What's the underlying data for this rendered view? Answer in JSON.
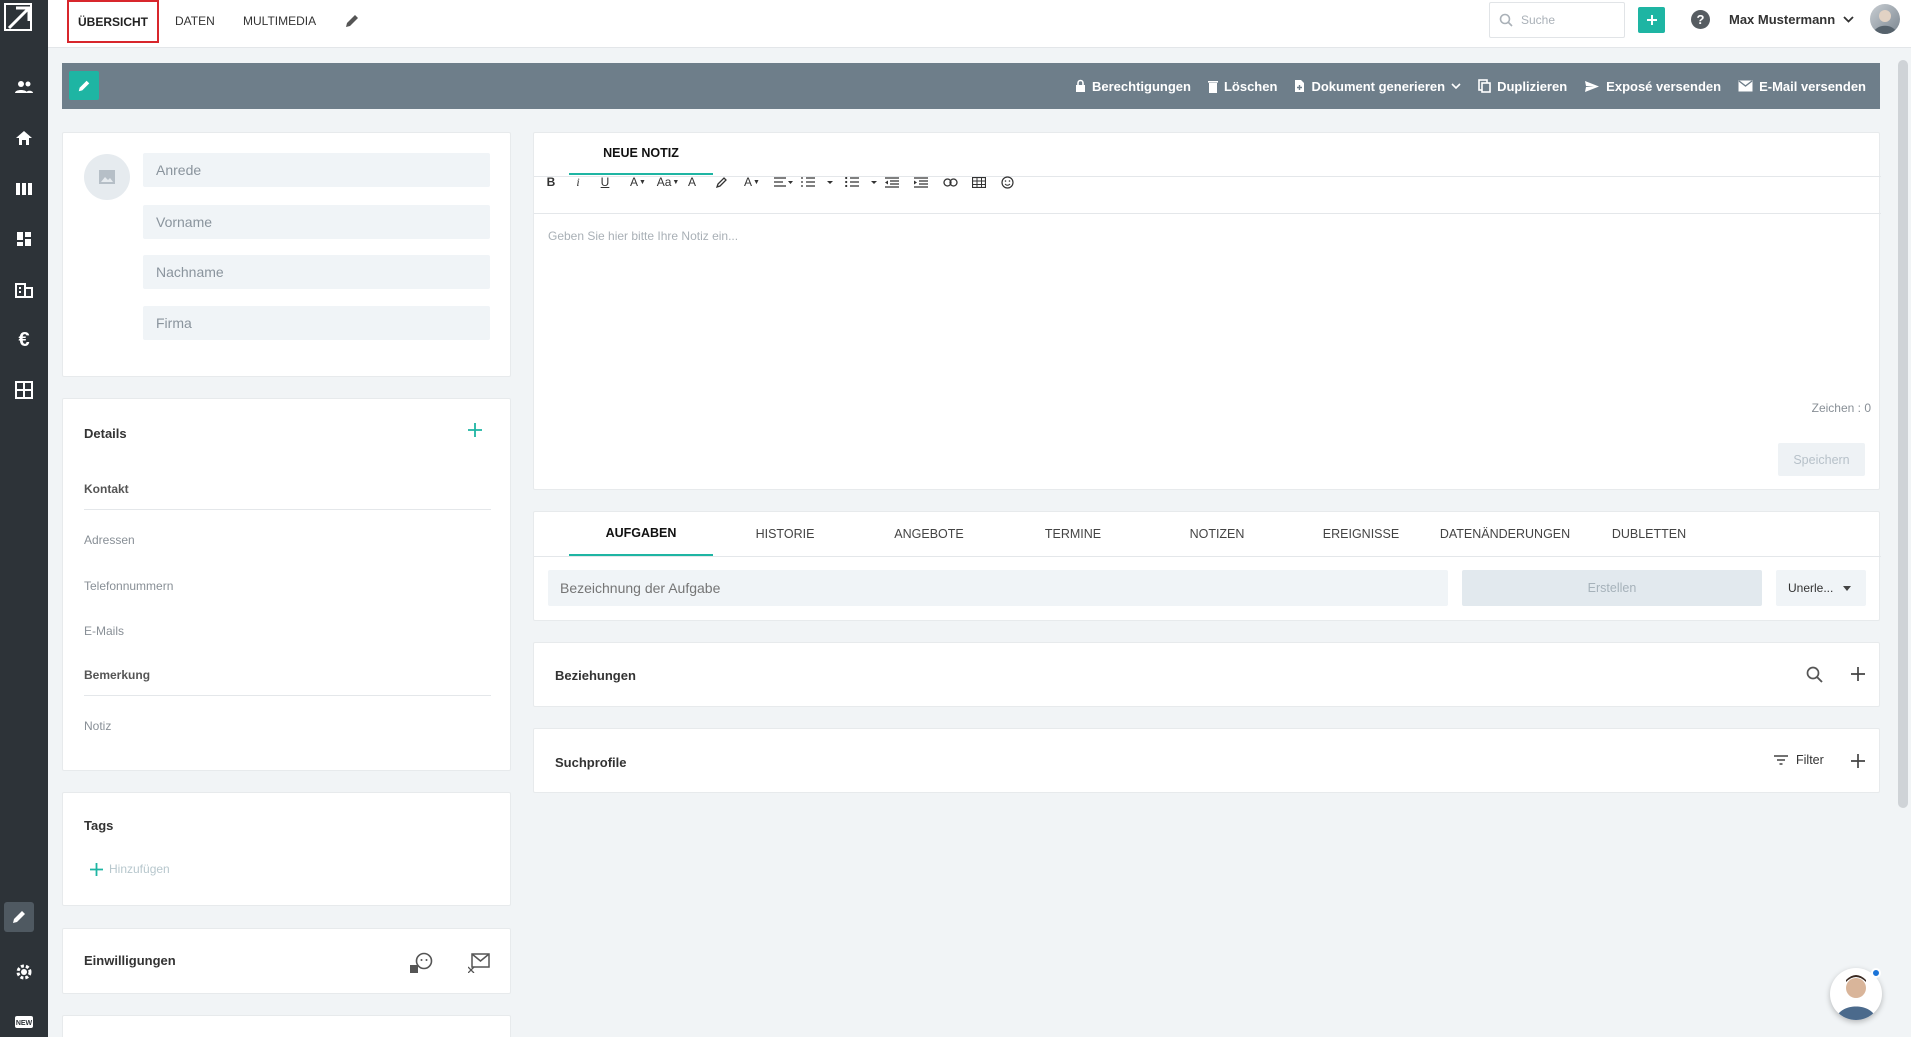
{
  "sidebar": {
    "icons": [
      "logo-icon",
      "contacts-icon",
      "home-icon",
      "books-icon",
      "dashboard-icon",
      "buildings-icon",
      "euro-icon",
      "grid-icon",
      "edit-icon",
      "settings-icon",
      "new-badge-icon"
    ]
  },
  "topbar": {
    "tabs": [
      {
        "label": "ÜBERSICHT"
      },
      {
        "label": "DATEN"
      },
      {
        "label": "MULTIMEDIA"
      }
    ],
    "search_placeholder": "Suche",
    "user_name": "Max Mustermann",
    "accent_color": "#1eb5a3"
  },
  "actionbar": {
    "actions": [
      {
        "label": "Berechtigungen",
        "icon": "lock-icon"
      },
      {
        "label": "Löschen",
        "icon": "trash-icon"
      },
      {
        "label": "Dokument generieren",
        "icon": "document-icon"
      },
      {
        "label": "Duplizieren",
        "icon": "copy-icon"
      },
      {
        "label": "Exposé versenden",
        "icon": "send-icon"
      },
      {
        "label": "E-Mail versenden",
        "icon": "mail-icon"
      }
    ]
  },
  "contact": {
    "fields": [
      {
        "placeholder": "Anrede"
      },
      {
        "placeholder": "Vorname"
      },
      {
        "placeholder": "Nachname"
      },
      {
        "placeholder": "Firma"
      }
    ]
  },
  "details": {
    "title": "Details",
    "kontakt_label": "Kontakt",
    "items": [
      "Adressen",
      "Telefonnummern",
      "E-Mails"
    ],
    "bemerkung_label": "Bemerkung",
    "notiz_label": "Notiz"
  },
  "tags": {
    "title": "Tags",
    "add_label": "Hinzufügen"
  },
  "einwilligungen": {
    "title": "Einwilligungen"
  },
  "note": {
    "tab_label": "NEUE NOTIZ",
    "placeholder": "Geben Sie hier bitte Ihre Notiz ein...",
    "char_count": "Zeichen : 0",
    "save_label": "Speichern",
    "toolbar": [
      "B",
      "i",
      "U",
      "A",
      "Aa",
      "A",
      "",
      "",
      "A",
      "",
      "",
      "",
      "",
      "",
      "",
      "",
      ""
    ]
  },
  "tasks": {
    "tabs": [
      "AUFGABEN",
      "HISTORIE",
      "ANGEBOTE",
      "TERMINE",
      "NOTIZEN",
      "EREIGNISSE",
      "DATENÄNDERUNGEN",
      "DUBLETTEN"
    ],
    "input_placeholder": "Bezeichnung der Aufgabe",
    "create_label": "Erstellen",
    "select_value": "Unerle..."
  },
  "beziehungen": {
    "title": "Beziehungen"
  },
  "suchprofile": {
    "title": "Suchprofile",
    "filter_label": "Filter"
  }
}
